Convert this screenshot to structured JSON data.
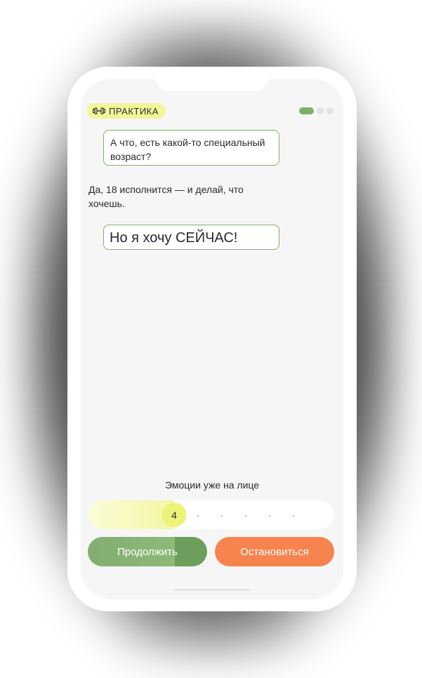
{
  "header": {
    "badge_label": "ПРАКТИКА",
    "badge_icon": "dumbbell-icon",
    "progress": {
      "total": 3,
      "current": 1
    }
  },
  "chat": {
    "messages": [
      {
        "author": "user",
        "text": "А что, есть какой-то специальный возраст?"
      },
      {
        "author": "other",
        "text": "Да, 18 исполнится — и делай, что хочешь."
      },
      {
        "author": "user",
        "text": "Но я хочу СЕЙЧАС!"
      }
    ]
  },
  "emotion": {
    "label": "Эмоции уже на лице",
    "value": 4,
    "max": 10,
    "value_display": "4",
    "tick_glyph": "-"
  },
  "actions": {
    "continue_label": "Продолжить",
    "stop_label": "Остановиться"
  },
  "colors": {
    "accent_green": "#7fb068",
    "badge_yellow": "#f2f59a",
    "stop_orange": "#f7834e"
  }
}
